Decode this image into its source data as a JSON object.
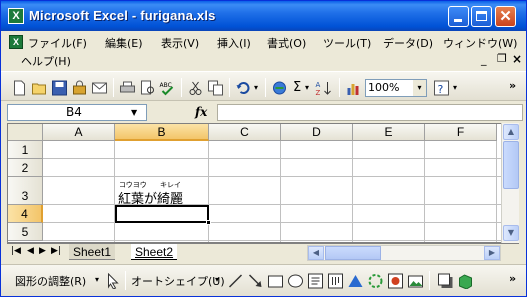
{
  "window": {
    "title": "Microsoft Excel - furigana.xls",
    "app_icon": "excel-icon"
  },
  "menu": {
    "items": [
      "ファイル(F)",
      "編集(E)",
      "表示(V)",
      "挿入(I)",
      "書式(O)",
      "ツール(T)",
      "データ(D)",
      "ウィンドウ(W)",
      "ヘルプ(H)"
    ]
  },
  "toolbar": {
    "zoom": "100%"
  },
  "formula_bar": {
    "name_box": "B4",
    "fx_label": "fx",
    "formula": ""
  },
  "sheet": {
    "columns": [
      "A",
      "B",
      "C",
      "D",
      "E",
      "F"
    ],
    "rows": [
      "1",
      "2",
      "3",
      "4",
      "5"
    ],
    "active_cell": "B4",
    "cells": {
      "B3": {
        "text": "紅葉が綺麗",
        "furigana_1": "コウヨウ",
        "furigana_2": "キレイ"
      }
    }
  },
  "tabs": {
    "sheets": [
      "Sheet1",
      "Sheet2"
    ],
    "active": "Sheet2"
  },
  "drawing_bar": {
    "draw_label": "図形の調整(R)",
    "autoshape_label": "オートシェイプ(U)"
  },
  "colors": {
    "titlebar": "#0a5fe8",
    "active_header": "#f3c56a",
    "excel_green": "#1d7a3a"
  }
}
